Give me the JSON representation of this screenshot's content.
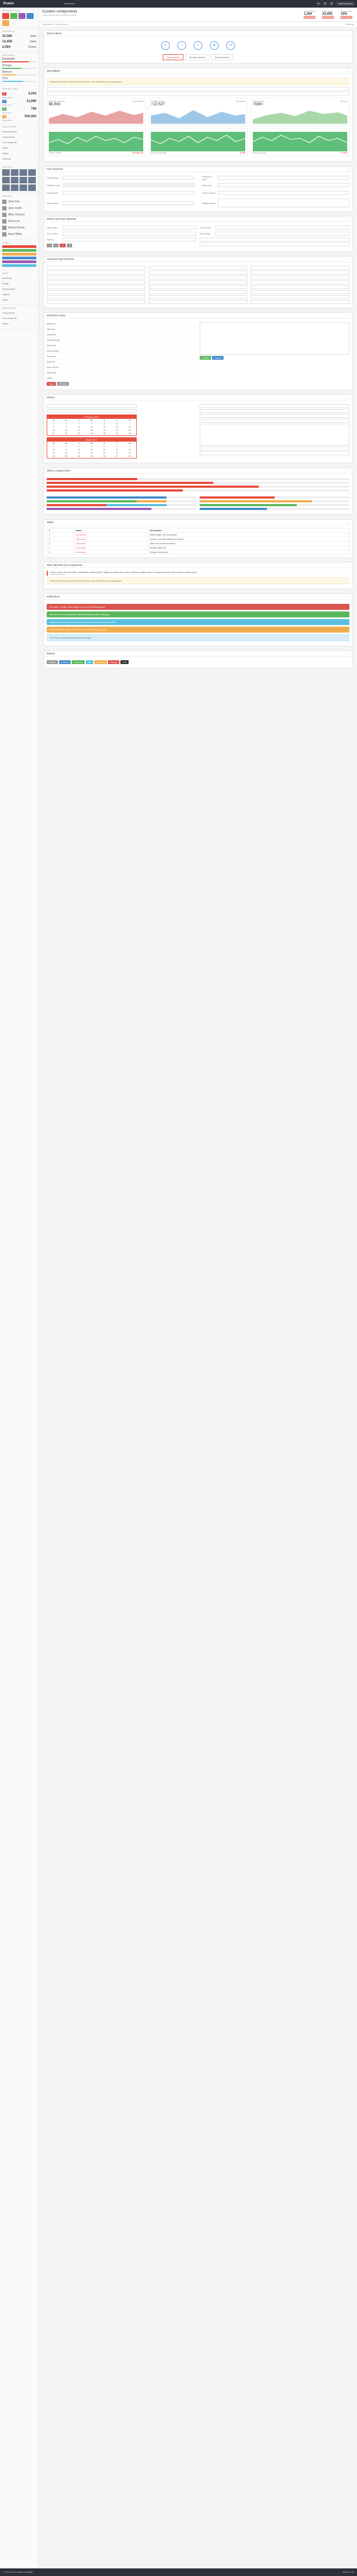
{
  "app": {
    "brand": "Proton",
    "nav_left": "Dashboard",
    "user": "Admin Account"
  },
  "header": {
    "title": "Custom components",
    "subtitle": "Components used inside the theme",
    "stats": [
      {
        "label": "New visitors",
        "value": "1,284"
      },
      {
        "label": "Page views",
        "value": "23,458"
      },
      {
        "label": "Bounce rate",
        "value": "34%"
      }
    ]
  },
  "breadcrumb": {
    "items": [
      "Dashboard",
      "Components"
    ],
    "right": "Settings"
  },
  "sidebar": {
    "sections": [
      {
        "title": "Quick buttons"
      },
      {
        "title": "Statistics"
      },
      {
        "title": "Progress"
      },
      {
        "title": "Server load"
      },
      {
        "title": "Categories"
      },
      {
        "title": "Gallery"
      },
      {
        "title": "Friends"
      },
      {
        "title": "Labels"
      },
      {
        "title": "Tags"
      },
      {
        "title": "Navigation"
      }
    ],
    "stats": [
      {
        "label": "Visits",
        "value": "32,566"
      },
      {
        "label": "Sales",
        "value": "12,456"
      },
      {
        "label": "Orders",
        "value": "2,584"
      }
    ],
    "progress": [
      {
        "label": "Bandwidth",
        "pct": 78,
        "color": "#e74c3c"
      },
      {
        "label": "Storage",
        "pct": 55,
        "color": "#5cb85c"
      },
      {
        "label": "Memory",
        "pct": 40,
        "color": "#f0ad4e"
      },
      {
        "label": "CPU",
        "pct": 62,
        "color": "#5bc0de"
      }
    ],
    "server": [
      {
        "value": "4,254",
        "label": "Users online"
      },
      {
        "value": "13,899",
        "label": "Total users"
      },
      {
        "value": "769",
        "label": "New users"
      },
      {
        "value": "500,000",
        "label": "Page views"
      }
    ],
    "links": [
      "Documentation",
      "Components",
      "Form elements",
      "Tables",
      "Charts",
      "Calendar"
    ],
    "friends": [
      "John Doe",
      "Jane Smith",
      "Mike Johnson",
      "Anna Lee",
      "Robert Brown",
      "Mary White"
    ],
    "tags": [
      "Marketing",
      "Design",
      "Development",
      "Support",
      "Sales"
    ],
    "nav": [
      "Components",
      "Form elements",
      "Tables"
    ]
  },
  "sections": {
    "quick": {
      "title": "Quick buttons",
      "tabs": [
        "Quick buttons",
        "Rounded buttons",
        "Square buttons"
      ]
    },
    "widgets": {
      "title": "Stat widgets",
      "alert": "Attention! Please check the dashboard for new notifications and messages."
    },
    "w3": [
      {
        "name": "Monthly revenue",
        "value": "$6,800",
        "extra": "Last month"
      },
      {
        "name": "Weekly visitors",
        "value": "+12,527",
        "extra": "This week"
      },
      {
        "name": "Total orders",
        "value": "7688+",
        "extra": "All time"
      }
    ],
    "w3b": [
      {
        "name": "Server traffic",
        "value": "+$7,827.21",
        "extra": "Today"
      },
      {
        "name": "Revenue stream",
        "value": "-3,753",
        "extra": "Monthly"
      },
      {
        "name": "Products sold",
        "value": "+7,015",
        "extra": "Weekly"
      }
    ],
    "form": {
      "title": "Form elements",
      "labels": [
        "Default input",
        "Password input",
        "Disabled input",
        "Read-only",
        "Placeholder",
        "Custom select",
        "Styled select",
        "Multiple select"
      ],
      "placeholder": "Enter text..."
    },
    "datepicker": {
      "title": "Pickers and other elements",
      "labels": [
        "Date picker",
        "Time picker",
        "Color picker",
        "Date range",
        "Spinner"
      ]
    },
    "advanced": {
      "title": "Advanced input elements"
    },
    "wysiwyg": {
      "title": "WYSIWYG editor",
      "links": [
        "Bold text",
        "Italic text",
        "Underline",
        "Strikethrough",
        "Insert link",
        "Insert image",
        "Insert list",
        "Align left",
        "Align center",
        "Align right",
        "Undo"
      ],
      "buttons": [
        "Save",
        "Preview",
        "Publish",
        "Cancel"
      ]
    },
    "pickers": {
      "title": "Pickers",
      "month": "February 2014",
      "month2": "March 2014",
      "weekdays": [
        "Su",
        "Mo",
        "Tu",
        "We",
        "Th",
        "Fr",
        "Sa"
      ]
    },
    "sliders": {
      "title": "Sliders, progress bars"
    },
    "tables": {
      "title": "Tables",
      "headers": [
        "#",
        "Name",
        "Description"
      ],
      "rows": [
        [
          "1",
          "Link name",
          "Default table row description"
        ],
        [
          "2",
          "Link name",
          "Another row with additional content"
        ],
        [
          "3",
          "Link name",
          "Table row content example"
        ],
        [
          "4",
          "Link name",
          "Sample data row"
        ],
        [
          "5",
          "Link name",
          "Sample description"
        ]
      ]
    },
    "other": {
      "title": "Other elements and components",
      "blockquote": "Lorem ipsum dolor sit amet, consectetur adipiscing elit. Integer posuere erat a ante. Vivamus sagittis lacus vel augue laoreet rutrum faucibus dolor auctor.",
      "source": "Someone famous"
    },
    "notifications": {
      "title": "Notifications",
      "alerts": [
        {
          "type": "red",
          "text": "Oh snap! Change a few things up and try submitting again."
        },
        {
          "type": "green",
          "text": "Well done! You successfully read this important alert message."
        },
        {
          "type": "blue",
          "text": "Heads up! This alert needs your attention, but it's not super important."
        },
        {
          "type": "yellow",
          "text": "Warning! Better check yourself, you're not looking too good."
        },
        {
          "type": "info",
          "text": "Info! This is an informational alert message."
        }
      ]
    },
    "buttons": {
      "title": "Buttons",
      "labels": [
        "Default",
        "Primary",
        "Success",
        "Info",
        "Warning",
        "Danger",
        "Link"
      ]
    }
  },
  "footer": {
    "left": "© 2014 Proton admin template",
    "right": "Back to top"
  }
}
